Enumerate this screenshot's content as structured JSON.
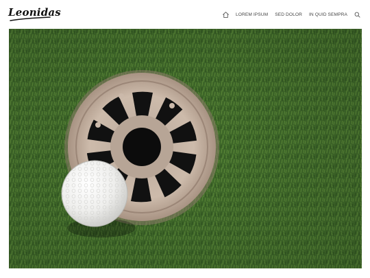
{
  "site": {
    "logo_text": "Leonidas"
  },
  "nav": {
    "home_icon": "home-icon",
    "items": [
      {
        "label": "LOREM IPSUM"
      },
      {
        "label": "SED DOLOR"
      },
      {
        "label": "IN QUID SEMPRA"
      }
    ],
    "search_icon": "search-icon"
  },
  "hero": {
    "subject": "golf-ball-beside-cup-on-green",
    "colors": {
      "grass": "#3f6a2a",
      "cup_rim": "#c9b7a6",
      "ball": "#f2f2f0"
    }
  }
}
